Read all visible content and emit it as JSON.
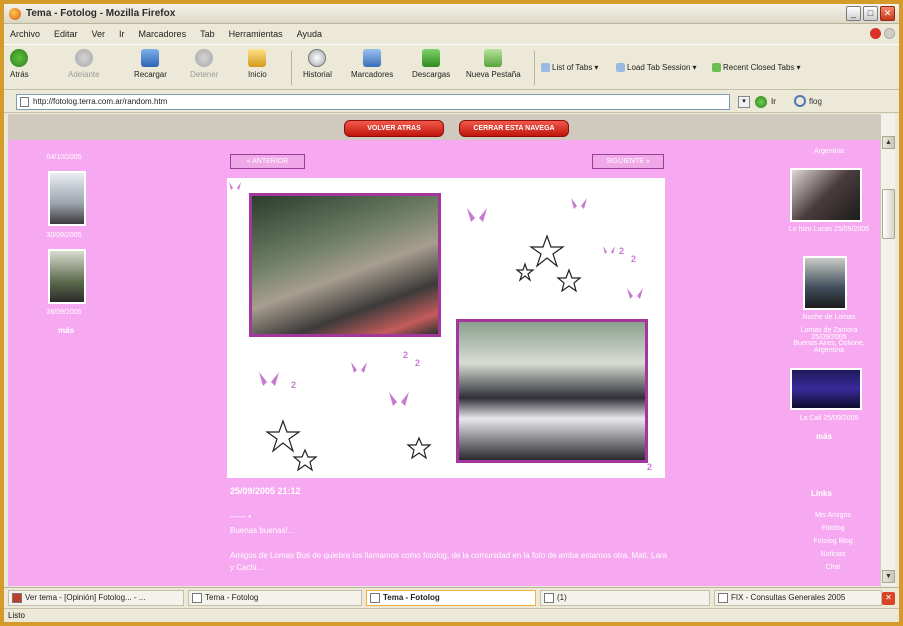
{
  "window": {
    "title": "Tema - Fotolog - Mozilla Firefox"
  },
  "menu": [
    "Archivo",
    "Editar",
    "Ver",
    "Ir",
    "Marcadores",
    "Tab",
    "Herramientas",
    "Ayuda"
  ],
  "toolbar": {
    "back": "Atrás",
    "forward": "Adelante",
    "reload": "Recargar",
    "stop": "Detener",
    "home": "Inicio",
    "history": "Historial",
    "bookmarks": "Marcadores",
    "downloads": "Descargas",
    "new_tab": "Nueva Pestaña",
    "list_tabs": "List of Tabs",
    "load_session": "Load Tab Session",
    "closed_tabs": "Recent Closed Tabs"
  },
  "address": {
    "url": "http://fotolog.terra.com.ar/random.htm",
    "go": "Ir",
    "search_engine": "flog"
  },
  "page": {
    "btn_left": "VOLVER ATRAS",
    "btn_right": "CERRAR ESTA NAVEGA",
    "prev_label": "« ANTERIOR",
    "next_label": "SIGUIENTE »",
    "date": "25/09/2005 21:12",
    "dash": "—— •",
    "greeting": "Buenas buenas!...",
    "body": "Amigos de Lomas Bus de quiebra los llamamos como fotolog, de la comunidad en la foto de amba estamos otra. Mati, Lara y Cachi...",
    "left_caps": [
      "04/10/2005",
      "30/09/2005",
      "28/09/2005"
    ],
    "left_more": "más",
    "right_caps": [
      "Argentina",
      "Lo hizo Lucas 25/09/2005",
      "Noche de Lomas",
      "Lomas de Zamora 25/09/2005",
      "Buenos Aires, Ostione, Argentina",
      "La Cali 25/09/2005"
    ],
    "right_more": "más",
    "links_title": "Links",
    "links": [
      "Mis Amigos",
      "Fotolog",
      "Fotolog Blog",
      "Noticias",
      "Chat"
    ]
  },
  "tasks": [
    "Ver tema - [Opinión] Fotolog... - ...",
    "Tema - Fotolog",
    "Tema - Fotolog",
    "(1)",
    "FIX - Consultas Generales 2005"
  ],
  "status": "Listo"
}
